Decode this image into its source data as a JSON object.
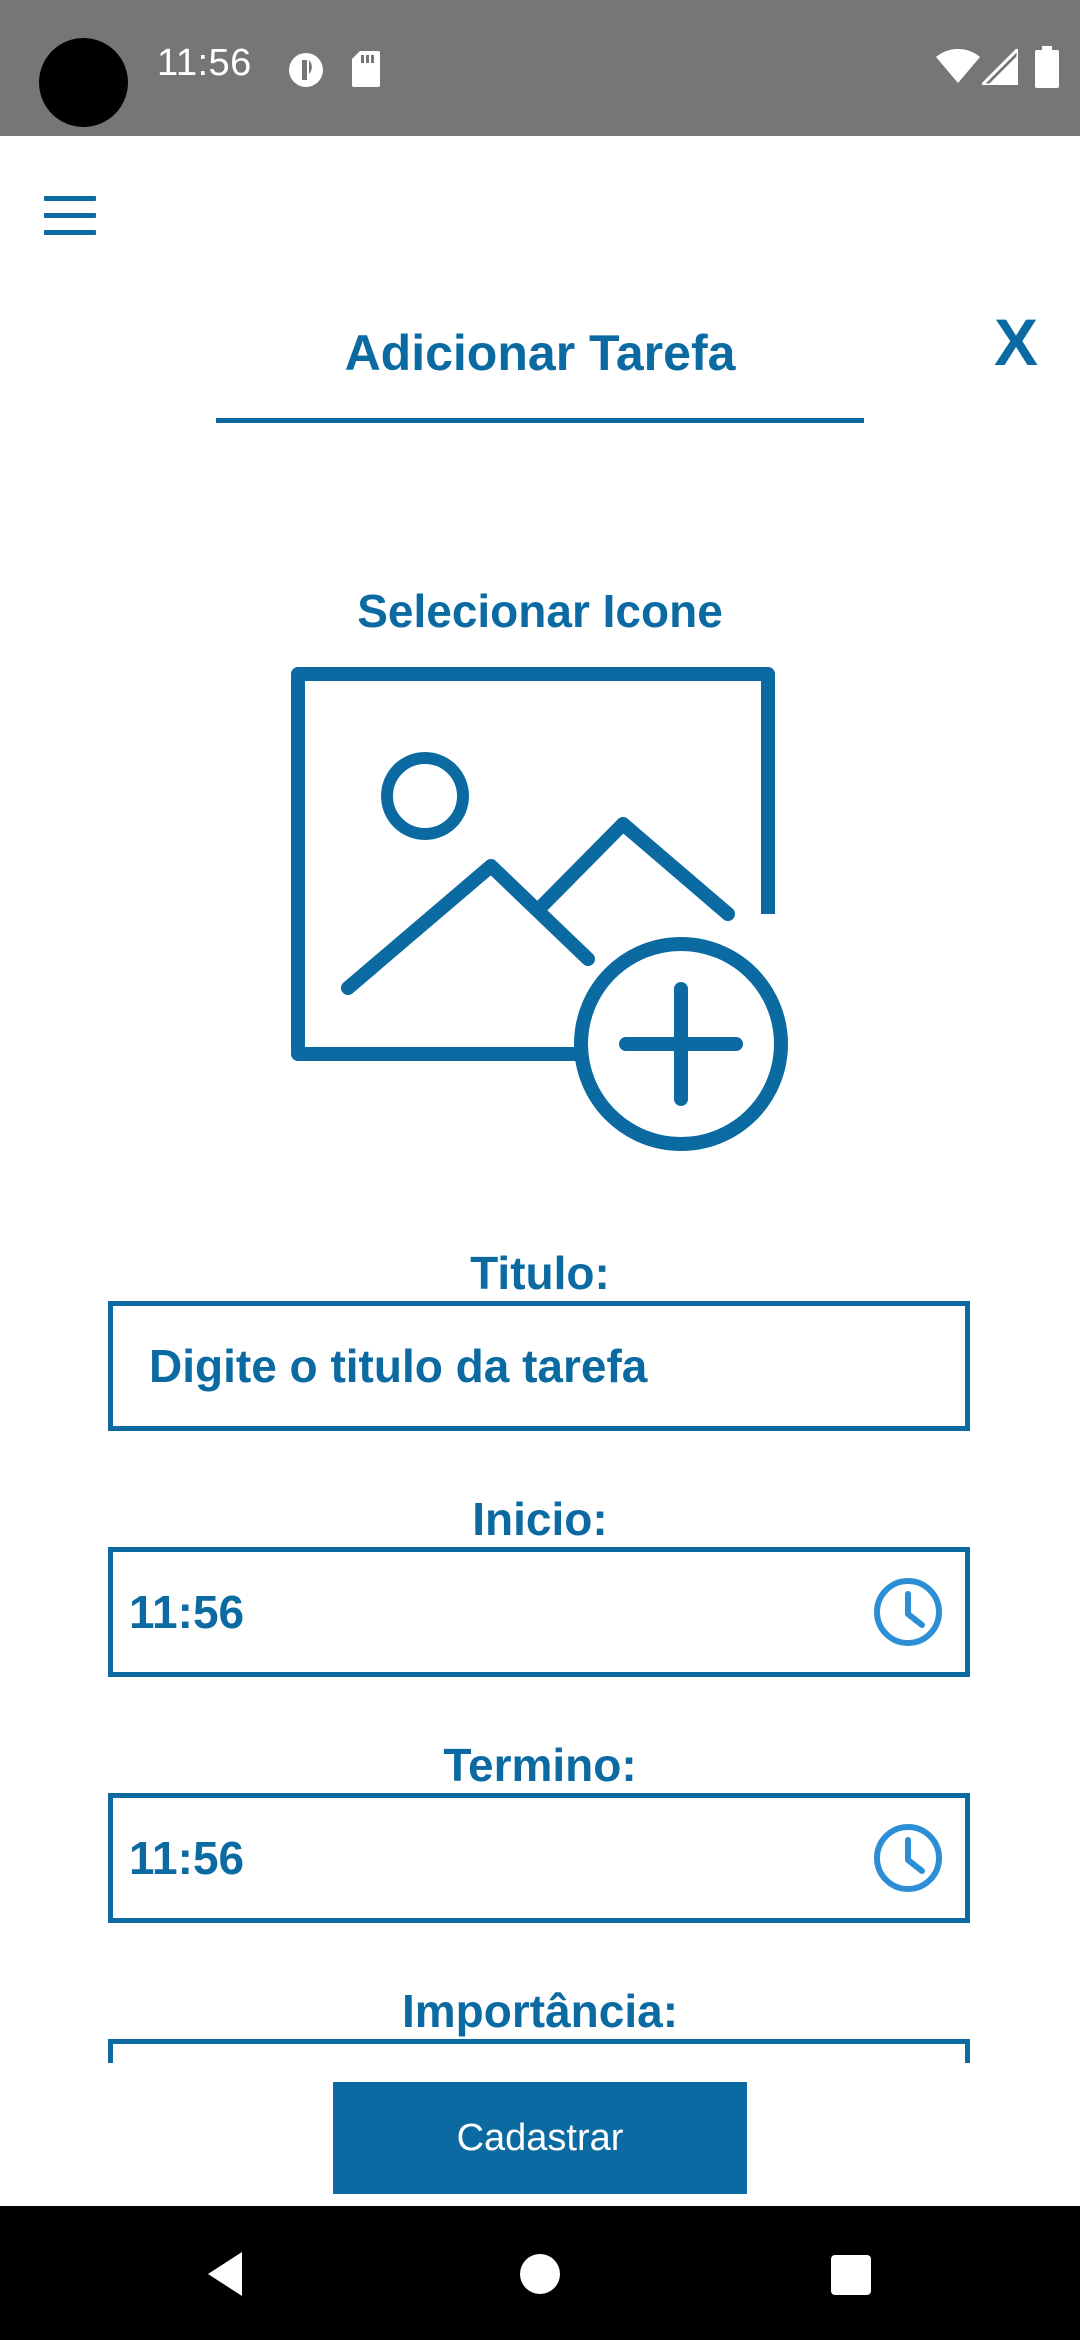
{
  "status_bar": {
    "time": "11:56",
    "icons": [
      "camera-cutout",
      "data-saver-icon",
      "sd-card-icon",
      "wifi-icon",
      "signal-icon",
      "battery-icon"
    ]
  },
  "header": {
    "menu_icon": "hamburger-menu-icon",
    "close_label": "X",
    "title": "Adicionar Tarefa"
  },
  "icon_picker": {
    "label": "Selecionar Icone",
    "icon": "add-image-icon"
  },
  "form": {
    "titulo": {
      "label": "Titulo:",
      "placeholder": "Digite o titulo da tarefa"
    },
    "inicio": {
      "label": "Inicio:",
      "value": "11:56",
      "icon": "clock-icon"
    },
    "termino": {
      "label": "Termino:",
      "value": "11:56",
      "icon": "clock-icon"
    },
    "importancia": {
      "label": "Importância:"
    }
  },
  "submit_label": "Cadastrar",
  "nav_bar": {
    "icons": [
      "back-icon",
      "home-icon",
      "recents-icon"
    ]
  },
  "colors": {
    "accent": "#0a6aa1",
    "status_bar": "#767676",
    "clock_icon": "#2c8fd6"
  }
}
